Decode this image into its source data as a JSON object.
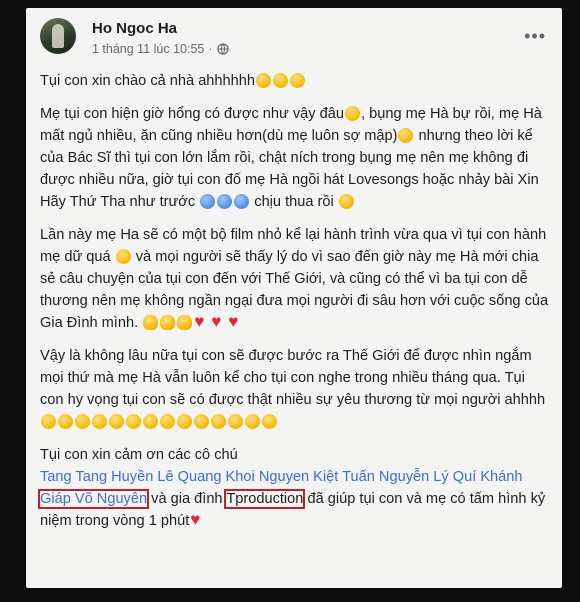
{
  "post": {
    "author": "Ho Ngoc Ha",
    "timestamp": "1 tháng 11 lúc 10:55",
    "separator": "·",
    "more_label": "•••"
  },
  "content": {
    "p1": "Tụi con xin chào cả nhà ahhhhhh",
    "p2a": "Mẹ tụi con hiện giờ hổng có được như vậy đâu",
    "p2b": ",  bụng mẹ Hà bự rồi,  mẹ Hà mất ngủ nhiều, ăn cũng nhiều hơn(dù mẹ luôn sợ mập)",
    "p2c": " nhưng theo lời kể của Bác Sĩ thì tụi con lớn lắm rồi, chật ních trong bụng mẹ nên mẹ không đi được nhiều nữa, giờ tụi con đố mẹ Hà ngồi hát Lovesongs hoặc nhảy bài Xin Hãy Thứ Tha như trước",
    "p2d": " chịu thua rồi",
    "p3a": "Lần này mẹ Ha sẽ có một bộ film nhỏ kể lại hành trình vừa qua vì tụi con hành mẹ dữ quá",
    "p3b": " và mọi người sẽ thấy lý do vì sao đến giờ này mẹ Hà mới chia sẻ câu chuyện của tụi con đến với Thế Giới, và cũng có thể vì ba tụi con dễ thương nên mẹ không ngần ngại đưa mọi người đi sâu hơn với cuộc sống của Gia Đình mình. ",
    "p4": "Vậy là không lâu nữa tụi con sẽ được bước ra Thế Giới để được nhìn ngắm mọi thứ mà mẹ Hà vẫn luôn kể cho tụi con nghe trong nhiều tháng qua.  Tụi con hy vọng tụi con sẽ có được thật nhiều sự yêu thương từ mọi người ahhhh",
    "p5_intro": "Tụi con xin cảm ơn các cô chú",
    "tags": [
      "Tang Tang Huyền",
      "Lê Quang Khoi",
      "Nguyen Kiệt",
      "Tuấn Nguyễn",
      "Lý Quí Khánh",
      "Giáp Võ Nguyên"
    ],
    "p5_mid": " và gia đình ",
    "tag_tproduction": "Tproduction",
    "p5_end": " đã giúp tụi con và mẹ có tấm hình kỷ niệm trong vòng 1 phút"
  },
  "icons": {
    "globe": "globe-icon",
    "more": "more-options-icon",
    "avatar": "profile-avatar"
  },
  "colors": {
    "link": "#3b6fd1",
    "highlight_box": "#c0202a",
    "text": "#1c1e21",
    "meta": "#65676b"
  }
}
